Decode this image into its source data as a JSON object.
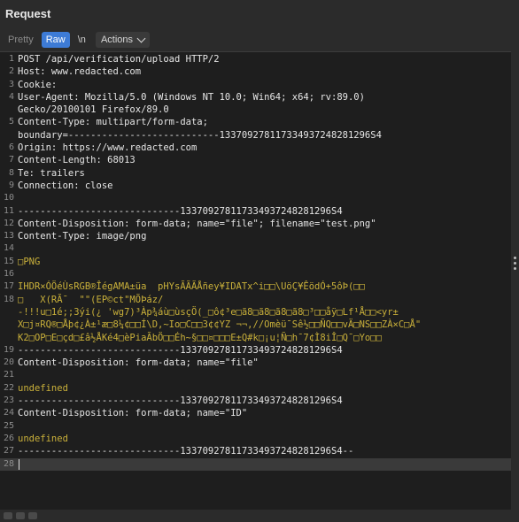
{
  "panel": {
    "title": "Request"
  },
  "toolbar": {
    "pretty_label": "Pretty",
    "raw_label": "Raw",
    "newline_label": "\\n",
    "actions_label": "Actions"
  },
  "editor": {
    "lines": [
      {
        "n": "1",
        "text": "POST /api/verification/upload HTTP/2",
        "color": "#e6e6e6"
      },
      {
        "n": "2",
        "text": "Host: www.redacted.com",
        "color": "#e6e6e6"
      },
      {
        "n": "3",
        "text": "Cookie:",
        "color": "#e6e6e6"
      },
      {
        "n": "4",
        "text": "User-Agent: Mozilla/5.0 (Windows NT 10.0; Win64; x64; rv:89.0)",
        "color": "#e6e6e6"
      },
      {
        "n": "",
        "text": "Gecko/20100101 Firefox/89.0",
        "color": "#e6e6e6"
      },
      {
        "n": "5",
        "text": "Content-Type: multipart/form-data;",
        "color": "#e6e6e6"
      },
      {
        "n": "",
        "text": "boundary=---------------------------133709278117334937248281296S4",
        "color": "#e6e6e6"
      },
      {
        "n": "6",
        "text": "Origin: https://www.redacted.com",
        "color": "#e6e6e6"
      },
      {
        "n": "7",
        "text": "Content-Length: 68013",
        "color": "#e6e6e6"
      },
      {
        "n": "8",
        "text": "Te: trailers",
        "color": "#e6e6e6"
      },
      {
        "n": "9",
        "text": "Connection: close",
        "color": "#e6e6e6"
      },
      {
        "n": "10",
        "text": "",
        "color": "#e6e6e6"
      },
      {
        "n": "11",
        "text": "-----------------------------133709278117334937248281296S4",
        "color": "#e6e6e6"
      },
      {
        "n": "12",
        "text": "Content-Disposition: form-data; name=\"file\"; filename=\"test.png\"",
        "color": "#e6e6e6"
      },
      {
        "n": "13",
        "text": "Content-Type: image/png",
        "color": "#e6e6e6"
      },
      {
        "n": "14",
        "text": "",
        "color": "#e6e6e6"
      },
      {
        "n": "15",
        "text": "□PNG",
        "color": "#c9b03a"
      },
      {
        "n": "16",
        "text": "",
        "color": "#e6e6e6"
      },
      {
        "n": "17",
        "text": "IHDR×ÓÖéÙsRGB®ÎégAMA±üa  pHYsÃÃÃÅñey¥IDATx^i□□\\UöÇ¥ÊödÓ+5ôÞ(□□",
        "color": "#c9b03a"
      },
      {
        "n": "18",
        "text": "□   X(RÃ¯  \"\"(EP©ct\"MÕÞáz/",
        "color": "#c9b03a"
      },
      {
        "n": "",
        "text": "-!!!u□1é;;3ýi(¿ 'wg7)³Àp¾áù□ùsçÖ(_□ô¢³e□ã8□ã8□ã8□ã8□³□□åÿ□Lf¹Å□□<yr±",
        "color": "#c9b03a"
      },
      {
        "n": "",
        "text": "X□j¤RQ®□Åþ¢¿À±¹æ□8¼¢□□Í\\D,~Io□C□□3¢¢YZ ¬¬,//Omèü¯Sê½□□ÑQ□□vÄ□NS□□ZÀ×C□Å\"",
        "color": "#c9b03a"
      },
      {
        "n": "",
        "text": "K2□OP□E□çd□£â½ÅKé4□èPiaÃbÖ□□Éh~§□□¤□□□E±Q#k□¡u¦Ñ□h¯7¢Ì8iÎ□Q¯□Yo□□",
        "color": "#c9b03a"
      },
      {
        "n": "19",
        "text": "-----------------------------133709278117334937248281296S4",
        "color": "#e6e6e6"
      },
      {
        "n": "20",
        "text": "Content-Disposition: form-data; name=\"file\"",
        "color": "#e6e6e6"
      },
      {
        "n": "21",
        "text": "",
        "color": "#e6e6e6"
      },
      {
        "n": "22",
        "text": "undefined",
        "color": "#c9b03a"
      },
      {
        "n": "23",
        "text": "-----------------------------133709278117334937248281296S4",
        "color": "#e6e6e6"
      },
      {
        "n": "24",
        "text": "Content-Disposition: form-data; name=\"ID\"",
        "color": "#e6e6e6"
      },
      {
        "n": "25",
        "text": "",
        "color": "#e6e6e6"
      },
      {
        "n": "26",
        "text": "undefined",
        "color": "#c9b03a"
      },
      {
        "n": "27",
        "text": "-----------------------------133709278117334937248281296S4--",
        "color": "#e6e6e6"
      },
      {
        "n": "28",
        "text": "",
        "color": "#e6e6e6",
        "cursor": true
      }
    ]
  }
}
